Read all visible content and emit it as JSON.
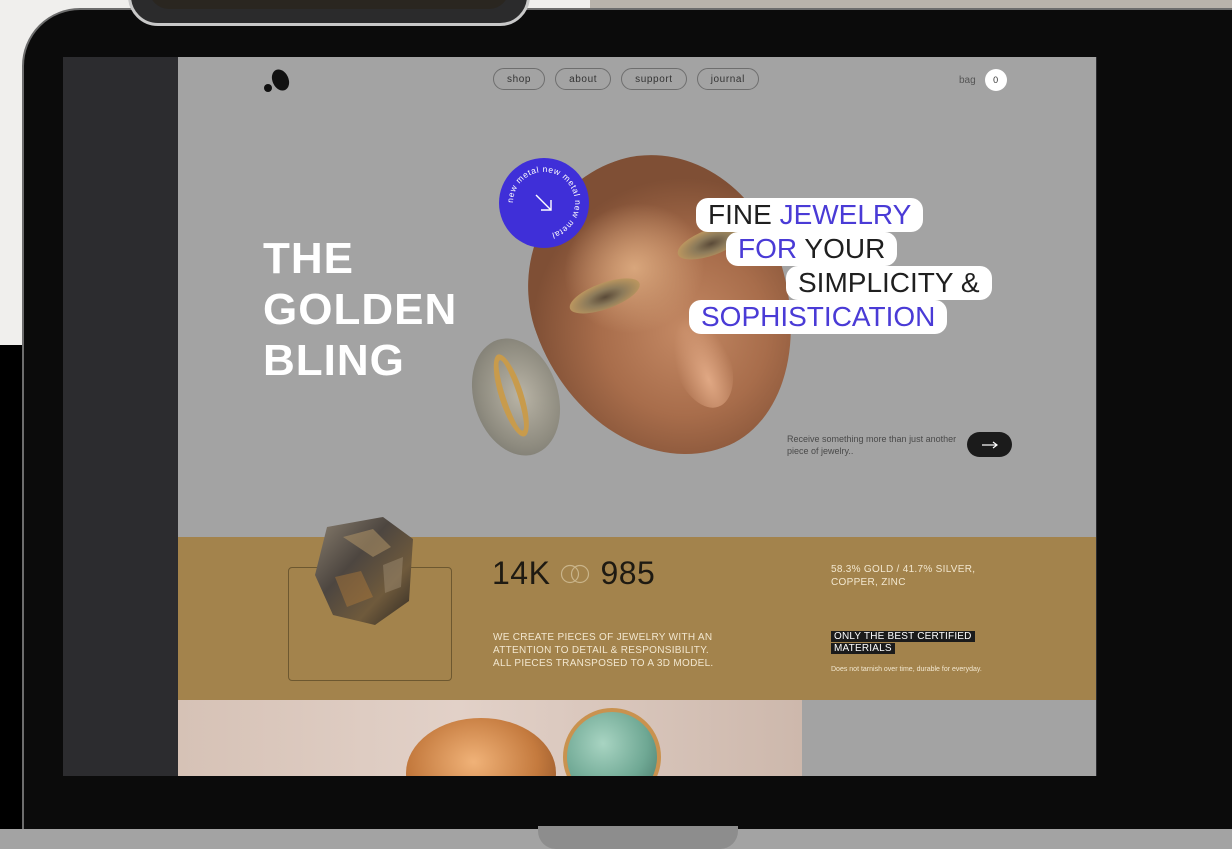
{
  "nav": {
    "items": [
      "shop",
      "about",
      "support",
      "journal"
    ],
    "bag_label": "bag",
    "bag_count": "0"
  },
  "hero": {
    "title_lines": [
      "THE",
      "GOLDEN",
      "BLING"
    ],
    "badge_text": "new metal new metal new metal",
    "tagline": [
      {
        "accent": "",
        "plain": "FINE ",
        "accent2": "JEWELRY"
      },
      {
        "accent": "FOR ",
        "plain": "YOUR",
        "accent2": ""
      },
      {
        "accent": "",
        "plain": "SIMPLICITY &",
        "accent2": ""
      },
      {
        "accent": "SOPHISTICATION",
        "plain": "",
        "accent2": ""
      }
    ],
    "receive_text": "Receive something more than just another piece of jewelry..",
    "accent_color": "#4a3bd6"
  },
  "stats": {
    "left_value": "14K",
    "right_value": "985",
    "description": "WE CREATE PIECES OF JEWELRY WITH AN ATTENTION TO DETAIL & RESPONSIBILITY. ALL PIECES TRANSPOSED TO A 3D MODEL.",
    "alloy": "58.3% GOLD / 41.7% SILVER, COPPER, ZINC",
    "certified": "ONLY THE BEST CERTIFIED MATERIALS",
    "certified_note": "Does not tarnish over time, durable for everyday.",
    "band_color": "#a3834c"
  },
  "icons": [
    "logo-icon",
    "arrow-down-right-icon",
    "arrow-right-icon",
    "interlocked-rings-icon"
  ]
}
